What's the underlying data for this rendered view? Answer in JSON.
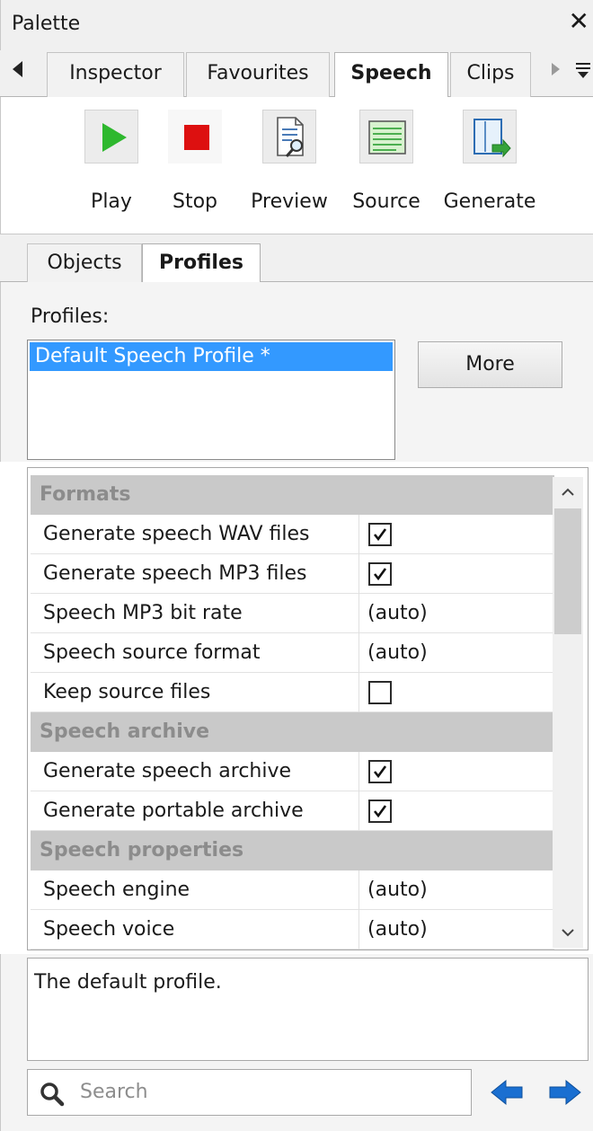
{
  "window": {
    "title": "Palette",
    "close_glyph": "✕"
  },
  "tabs": [
    {
      "label": "Inspector",
      "active": false
    },
    {
      "label": "Favourites",
      "active": false
    },
    {
      "label": "Speech",
      "active": true
    },
    {
      "label": "Clips",
      "active": false
    }
  ],
  "toolbar": {
    "play": "Play",
    "stop": "Stop",
    "preview": "Preview",
    "source": "Source",
    "generate": "Generate"
  },
  "inner_tabs": [
    {
      "label": "Objects",
      "active": false
    },
    {
      "label": "Profiles",
      "active": true
    }
  ],
  "profiles": {
    "label": "Profiles:",
    "items": [
      "Default Speech Profile *"
    ],
    "selected": "Default Speech Profile *",
    "more_button": "More"
  },
  "grid": {
    "categories": [
      "Formats",
      "Speech archive",
      "Speech properties"
    ],
    "rows": [
      {
        "name": "Generate speech WAV files",
        "checked": true
      },
      {
        "name": "Generate speech MP3 files",
        "checked": true
      },
      {
        "name": "Speech MP3 bit rate",
        "value": "(auto)"
      },
      {
        "name": "Speech source format",
        "value": "(auto)"
      },
      {
        "name": "Keep source files",
        "checked": false
      },
      {
        "name": "Generate speech archive",
        "checked": true
      },
      {
        "name": "Generate portable archive",
        "checked": true
      },
      {
        "name": "Speech engine",
        "value": "(auto)"
      },
      {
        "name": "Speech voice",
        "value": "(auto)"
      }
    ]
  },
  "description": "The default profile.",
  "search": {
    "placeholder": "Search"
  },
  "colors": {
    "play_green": "#2eb82e",
    "stop_red": "#dd1010",
    "selection_blue": "#3399ff",
    "nav_arrow_blue": "#1a6fd1",
    "category_bg": "#c9c9c9"
  },
  "icons": {
    "play": "play-icon",
    "stop": "stop-icon",
    "preview": "preview-document-magnifier-icon",
    "source": "source-list-icon",
    "generate": "generate-export-icon",
    "search": "search-icon",
    "back": "arrow-left-icon",
    "forward": "arrow-right-icon"
  }
}
